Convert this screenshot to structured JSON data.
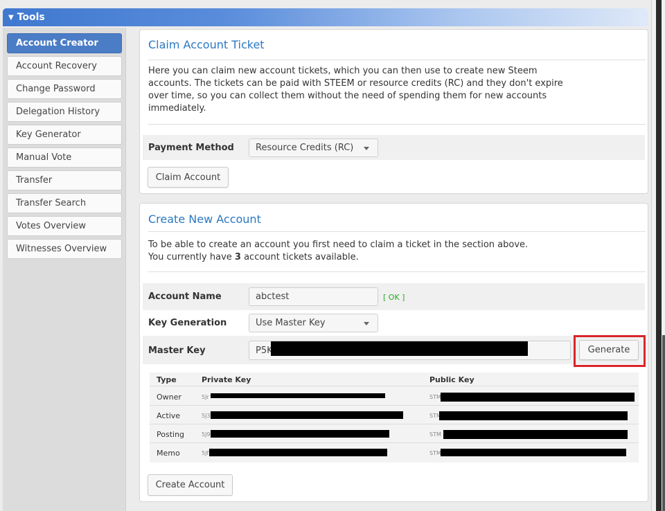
{
  "tools": {
    "title": "Tools"
  },
  "sidebar": {
    "items": [
      {
        "label": "Account Creator",
        "active": true
      },
      {
        "label": "Account Recovery"
      },
      {
        "label": "Change Password"
      },
      {
        "label": "Delegation History"
      },
      {
        "label": "Key Generator"
      },
      {
        "label": "Manual Vote"
      },
      {
        "label": "Transfer"
      },
      {
        "label": "Transfer Search"
      },
      {
        "label": "Votes Overview"
      },
      {
        "label": "Witnesses Overview"
      }
    ]
  },
  "claim": {
    "title": "Claim Account Ticket",
    "desc_1": "Here you can claim new account tickets, which you can then use to create new Steem",
    "desc_2": "accounts. The tickets can be paid with STEEM or resource credits (RC) and they don't expire",
    "desc_3": "over time, so you can collect them without the need of spending them for new accounts",
    "desc_4": "immediately.",
    "payment_label": "Payment Method",
    "payment_value": "Resource Credits (RC)",
    "claim_button": "Claim Account"
  },
  "create": {
    "title": "Create New Account",
    "desc_1": "To be able to create an account you first need to claim a ticket in the section above.",
    "desc_2_pre": "You currently have ",
    "ticket_count": "3",
    "desc_2_post": " account tickets available.",
    "account_name_label": "Account Name",
    "account_name_value": "abctest",
    "ok_text": "[ OK ]",
    "key_gen_label": "Key Generation",
    "key_gen_value": "Use Master Key",
    "master_key_label": "Master Key",
    "master_key_prefix": "P5K",
    "generate_button": "Generate",
    "create_button": "Create Account",
    "keys_table": {
      "headers": {
        "type": "Type",
        "private": "Private Key",
        "public": "Public Key"
      },
      "rows": [
        {
          "type": "Owner",
          "private_prefix": "5Jr",
          "public_prefix": "STM"
        },
        {
          "type": "Active",
          "private_prefix": "5J3",
          "public_prefix": "STM"
        },
        {
          "type": "Posting",
          "private_prefix": "5J9",
          "public_prefix": "STM"
        },
        {
          "type": "Memo",
          "private_prefix": "5Jf",
          "public_prefix": "STM"
        }
      ]
    }
  },
  "colors": {
    "accent": "#2a78c2",
    "active_tab": "#4b7cc6",
    "highlight": "#d9252b",
    "ok": "#22aa22"
  }
}
